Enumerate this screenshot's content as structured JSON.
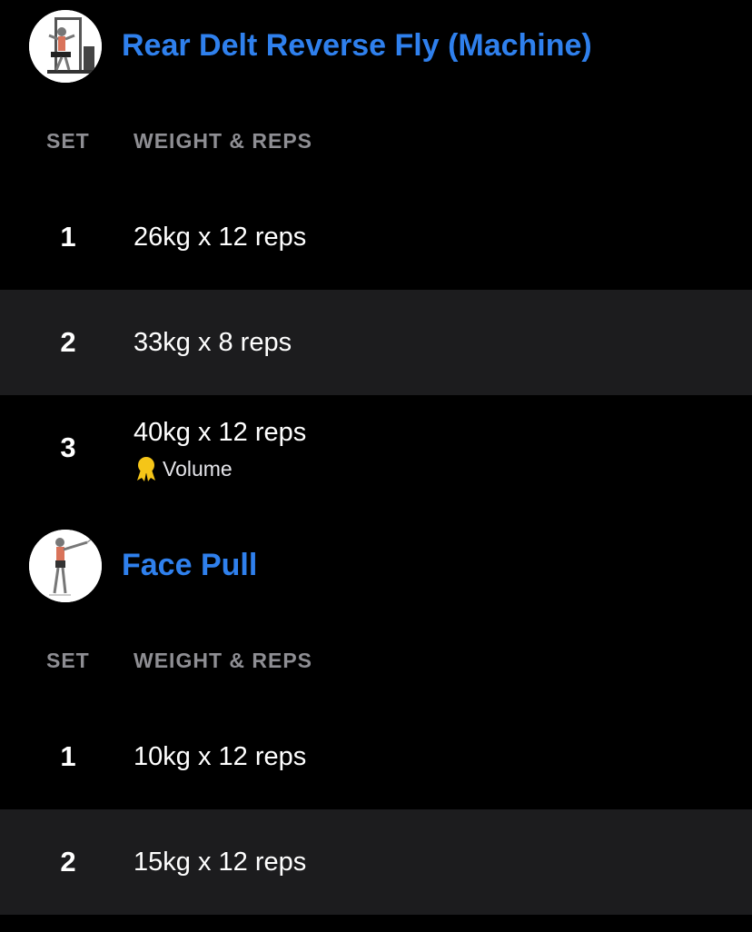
{
  "theme": {
    "title_color": "#2f80ed",
    "header_color": "#8e8e93",
    "alt_row_color": "#1c1c1e",
    "medal_color": "#f5c518"
  },
  "exercises": [
    {
      "name": "Rear Delt Reverse Fly (Machine)",
      "thumbnail_icon": "machine-exercise-illustration",
      "columns": {
        "set": "SET",
        "weight_reps": "WEIGHT & REPS"
      },
      "sets": [
        {
          "number": "1",
          "value": "26kg x 12 reps"
        },
        {
          "number": "2",
          "value": "33kg x 8 reps"
        },
        {
          "number": "3",
          "value": "40kg x 12 reps",
          "record": "Volume",
          "record_icon": "medal-icon"
        }
      ]
    },
    {
      "name": "Face Pull",
      "thumbnail_icon": "cable-exercise-illustration",
      "columns": {
        "set": "SET",
        "weight_reps": "WEIGHT & REPS"
      },
      "sets": [
        {
          "number": "1",
          "value": "10kg x 12 reps"
        },
        {
          "number": "2",
          "value": "15kg x 12 reps"
        }
      ]
    }
  ]
}
